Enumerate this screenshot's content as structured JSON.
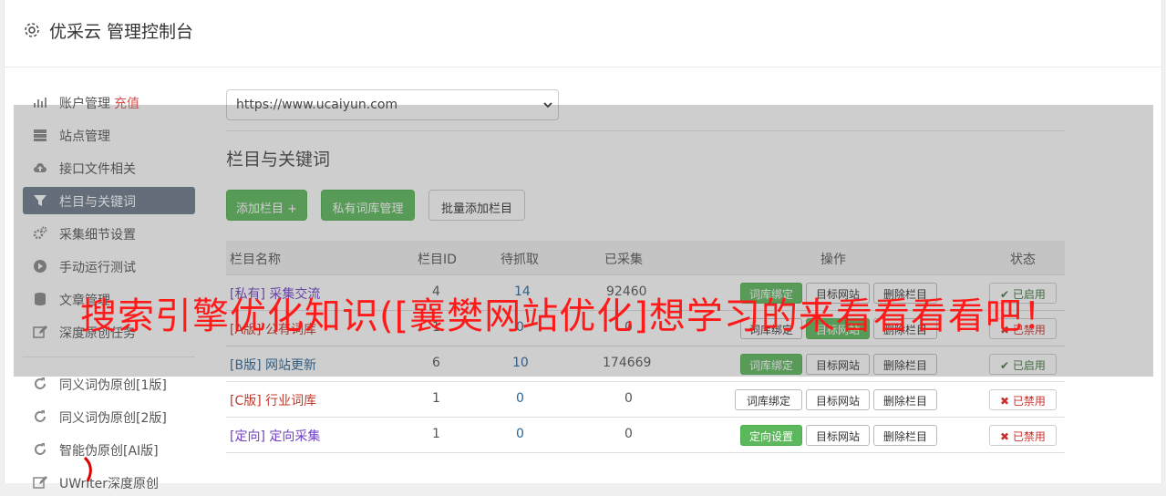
{
  "header": {
    "title": "优采云 管理控制台",
    "icon": "gear-icon"
  },
  "sidebar": {
    "items": [
      {
        "label": "账户管理",
        "extra": "充值",
        "icon": "bar-chart-icon"
      },
      {
        "label": "站点管理",
        "icon": "server-icon"
      },
      {
        "label": "接口文件相关",
        "icon": "cloud-upload-icon"
      },
      {
        "label": "栏目与关键词",
        "icon": "filter-icon",
        "active": true
      },
      {
        "label": "采集细节设置",
        "icon": "cogs-icon"
      },
      {
        "label": "手动运行测试",
        "icon": "play-circle-icon"
      },
      {
        "label": "文章管理",
        "icon": "database-icon"
      },
      {
        "label": "深度原创任务",
        "icon": "edit-icon"
      },
      {
        "label": "同义词伪原创[1版]",
        "icon": "refresh-icon"
      },
      {
        "label": "同义词伪原创[2版]",
        "icon": "refresh-icon"
      },
      {
        "label": "智能伪原创[AI版]",
        "icon": "refresh-icon"
      },
      {
        "label": "UWriter深度原创",
        "icon": "edit-icon"
      }
    ]
  },
  "site_select": {
    "value": "https://www.ucaiyun.com"
  },
  "section_title": "栏目与关键词",
  "buttons": {
    "add": "添加栏目 +",
    "private_lib": "私有词库管理",
    "batch_add": "批量添加栏目"
  },
  "table": {
    "headers": [
      "栏目名称",
      "栏目ID",
      "待抓取",
      "已采集",
      "操作",
      "状态"
    ],
    "rows": [
      {
        "tag": "[私有]",
        "name": "采集交流",
        "id": "4",
        "pending": "14",
        "collected": "92460",
        "action1": "词库绑定",
        "action2": "目标网站",
        "action3": "删除栏目",
        "status": "已启用",
        "style": "purple"
      },
      {
        "tag": "[A版]",
        "name": "公有词库",
        "id": "1",
        "pending": "0",
        "collected": "0",
        "action1": "词库绑定",
        "action2": "目标网站",
        "action3": "删除栏目",
        "status": "已禁用",
        "style": "red"
      },
      {
        "tag": "[B版]",
        "name": "网站更新",
        "id": "6",
        "pending": "10",
        "collected": "174669",
        "action1": "词库绑定",
        "action2": "目标网站",
        "action3": "删除栏目",
        "status": "已启用",
        "style": "link"
      },
      {
        "tag": "[C版]",
        "name": "行业词库",
        "id": "1",
        "pending": "0",
        "collected": "0",
        "action1": "词库绑定",
        "action2": "目标网站",
        "action3": "删除栏目",
        "status": "已禁用",
        "style": "red"
      },
      {
        "tag": "[定向]",
        "name": "定向采集",
        "id": "1",
        "pending": "0",
        "collected": "0",
        "action1": "定向设置",
        "action2": "目标网站",
        "action3": "删除栏目",
        "status": "已禁用",
        "style": "purple"
      }
    ]
  },
  "banner": "搜索引擎优化知识([襄樊网站优化]想学习的来看看看看吧！",
  "colors": {
    "green": "#5cb85c",
    "active": "#6d7b8d",
    "banner": "#ff1a1a"
  }
}
